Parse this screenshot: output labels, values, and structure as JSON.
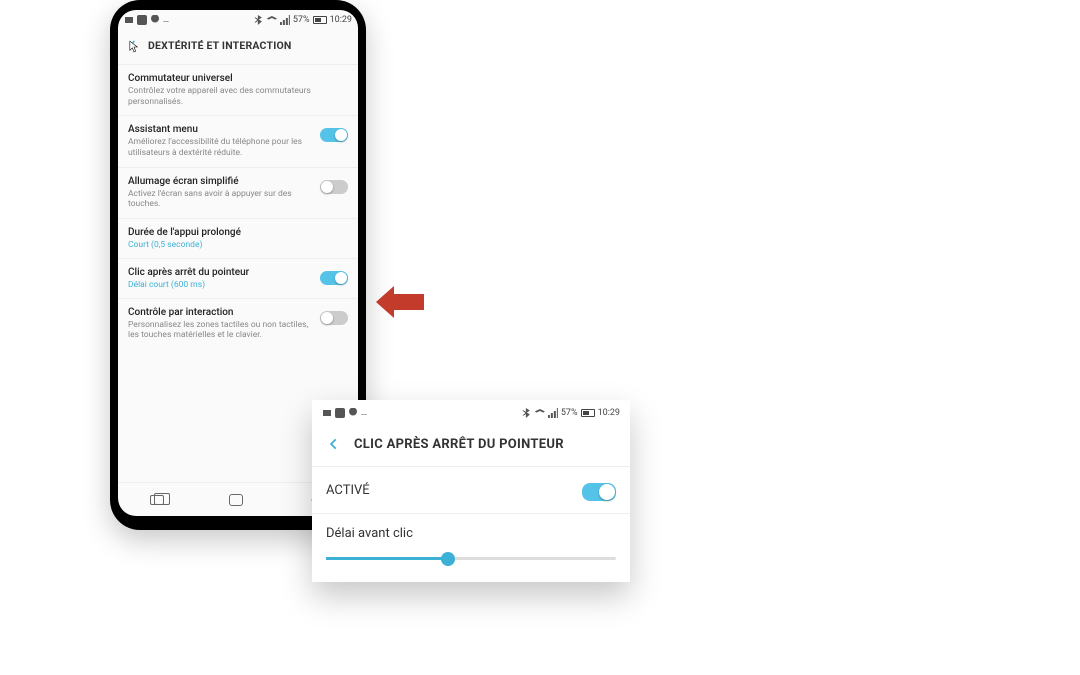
{
  "status": {
    "battery_pct": "57%",
    "time": "10:29"
  },
  "phone": {
    "header_title": "DEXTÉRITÉ ET INTERACTION",
    "items": [
      {
        "title": "Commutateur universel",
        "desc": "Contrôlez votre appareil avec des commutateurs personnalisés.",
        "toggle": null
      },
      {
        "title": "Assistant menu",
        "desc": "Améliorez l'accessibilité du téléphone pour les utilisateurs à dextérité réduite.",
        "toggle": "on"
      },
      {
        "title": "Allumage écran simplifié",
        "desc": "Activez l'écran sans avoir à appuyer sur des touches.",
        "toggle": "off"
      },
      {
        "title": "Durée de l'appui prolongé",
        "value": "Court (0,5 seconde)",
        "toggle": null
      },
      {
        "title": "Clic après arrêt du pointeur",
        "value": "Délai court (600 ms)",
        "toggle": "on"
      },
      {
        "title": "Contrôle par interaction",
        "desc": "Personnalisez les zones tactiles ou non tactiles, les touches matérielles et le clavier.",
        "toggle": "off"
      }
    ]
  },
  "detail": {
    "title": "CLIC APRÈS ARRÊT DU POINTEUR",
    "active_label": "ACTIVÉ",
    "active_state": "on",
    "slider_label": "Délai avant clic",
    "slider_pct": 42
  },
  "colors": {
    "accent": "#3db0d6",
    "arrow": "#c0392b"
  }
}
